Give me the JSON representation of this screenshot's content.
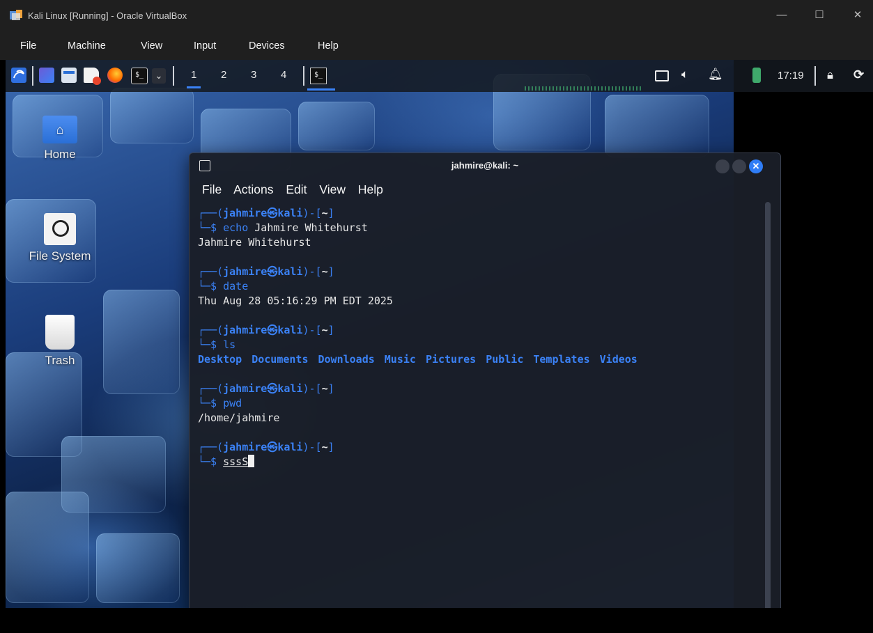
{
  "window": {
    "title": "Kali Linux  [Running] - Oracle VirtualBox",
    "menu": [
      "File",
      "Machine",
      "View",
      "Input",
      "Devices",
      "Help"
    ]
  },
  "panel": {
    "workspaces": [
      "1",
      "2",
      "3",
      "4"
    ],
    "active_workspace": "1",
    "clock": "17:19",
    "accent": "#3b82f6"
  },
  "desktop": {
    "icons": [
      {
        "label": "Home",
        "icon": "home-folder-icon"
      },
      {
        "label": "File System",
        "icon": "drive-icon"
      },
      {
        "label": "Trash",
        "icon": "trash-icon"
      }
    ]
  },
  "terminal": {
    "title": "jahmire@kali: ~",
    "menu": [
      "File",
      "Actions",
      "Edit",
      "View",
      "Help"
    ],
    "prompt": {
      "open": "┌──(",
      "user": "jahmire",
      "at": "㉿",
      "host": "kali",
      "mid": ")-[",
      "dir": "~",
      "close": "]",
      "arrow": "└─$ "
    },
    "session": [
      {
        "cmd": "echo",
        "args": " Jahmire Whitehurst",
        "output": "Jahmire Whitehurst"
      },
      {
        "cmd": "date",
        "args": "",
        "output": "Thu Aug 28 05:16:29 PM EDT 2025"
      },
      {
        "cmd": "ls",
        "args": "",
        "output_items": [
          "Desktop",
          "Documents",
          "Downloads",
          "Music",
          "Pictures",
          "Public",
          "Templates",
          "Videos"
        ]
      },
      {
        "cmd": "pwd",
        "args": "",
        "output": "/home/jahmire"
      }
    ],
    "current_input": "sssS"
  }
}
